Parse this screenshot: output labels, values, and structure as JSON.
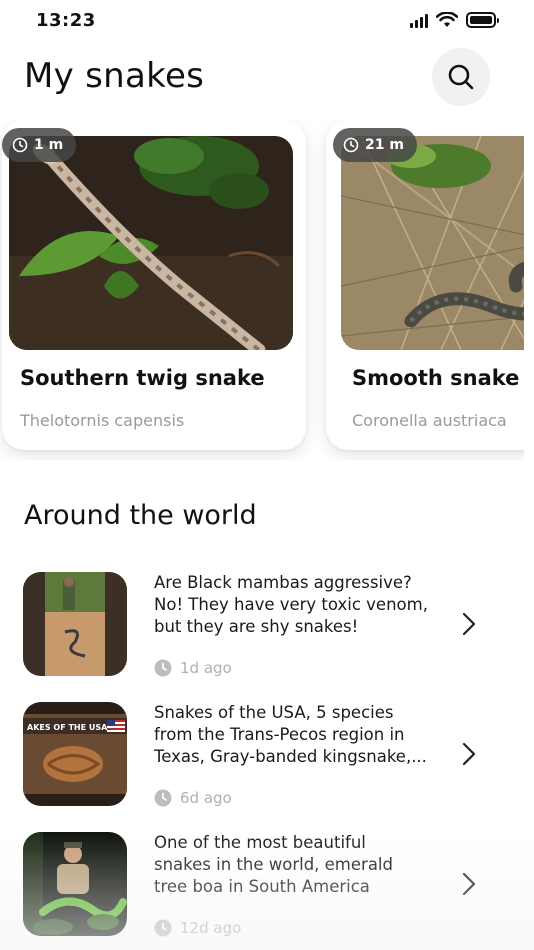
{
  "status_bar": {
    "time": "13:23",
    "signal_icon": "cellular-signal-icon",
    "wifi_icon": "wifi-icon",
    "battery_icon": "battery-icon"
  },
  "header": {
    "title": "My snakes",
    "search_icon": "search-icon"
  },
  "my_snakes": [
    {
      "badge": "1 m",
      "name": "Southern twig snake",
      "latin": "Thelotornis capensis"
    },
    {
      "badge": "21 m",
      "name": "Smooth snake",
      "latin": "Coronella austriaca"
    }
  ],
  "around_the_world": {
    "title": "Around the world",
    "items": [
      {
        "line1": "Are Black mambas aggressive?",
        "line2": "No! They have very toxic venom,",
        "line3": "but they are shy snakes!",
        "time": "1d ago"
      },
      {
        "line1": "Snakes of the USA, 5 species",
        "line2": "from the Trans-Pecos region in",
        "line3": "Texas, Gray-banded kingsnake,...",
        "time": "6d ago",
        "thumb_caption": "AKES OF THE USA"
      },
      {
        "line1": "One of the most beautiful",
        "line2": "snakes in the world, emerald",
        "line3": "tree boa in South America",
        "time": "12d ago"
      }
    ]
  },
  "colors": {
    "badge_bg": "#464646",
    "muted_text": "#9a9a9a",
    "time_text": "#b0b0b0",
    "search_bg": "#f1f1f1"
  }
}
